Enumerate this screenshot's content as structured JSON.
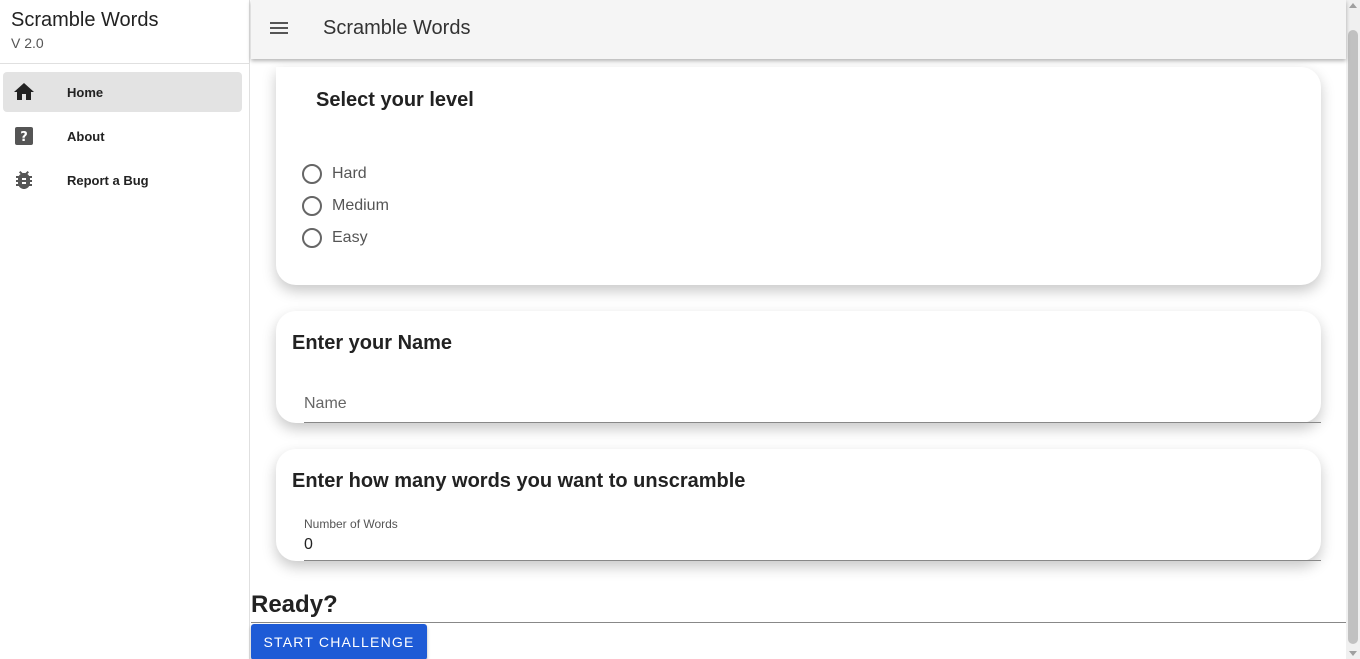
{
  "sidebar": {
    "title": "Scramble Words",
    "version": "V 2.0",
    "items": [
      {
        "label": "Home",
        "icon": "home-icon",
        "active": true
      },
      {
        "label": "About",
        "icon": "help-icon",
        "active": false
      },
      {
        "label": "Report a Bug",
        "icon": "bug-icon",
        "active": false
      }
    ]
  },
  "appbar": {
    "menu_icon": "menu-icon",
    "title": "Scramble Words"
  },
  "level": {
    "title": "Select your level",
    "options": [
      "Hard",
      "Medium",
      "Easy"
    ]
  },
  "name": {
    "title": "Enter your Name",
    "placeholder": "Name",
    "value": ""
  },
  "words": {
    "title": "Enter how many words you want to unscramble",
    "label": "Number of Words",
    "value": "0"
  },
  "footer": {
    "ready": "Ready?",
    "start_label": "START CHALLENGE"
  },
  "colors": {
    "primary": "#1e5bd6",
    "appbar_bg": "#f5f5f5",
    "active_nav_bg": "#e3e3e3"
  }
}
